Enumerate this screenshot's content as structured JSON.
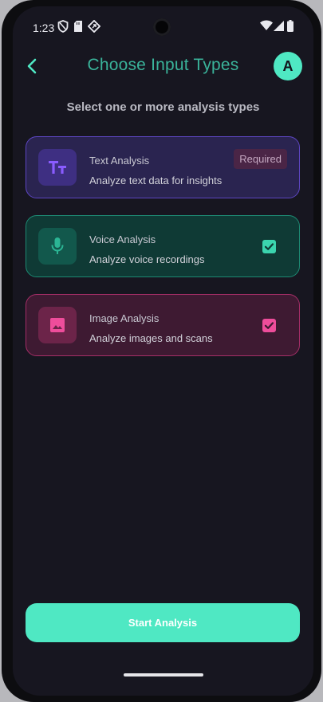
{
  "status_bar": {
    "time": "1:23",
    "icons": [
      "shield-icon",
      "sd-card-icon",
      "link-icon",
      "wifi-icon",
      "signal-icon",
      "battery-icon"
    ]
  },
  "header": {
    "title": "Choose Input Types",
    "back_icon": "chevron-left-icon",
    "avatar_initial": "A"
  },
  "subtitle": "Select one or more analysis types",
  "options": [
    {
      "title": "Text Analysis",
      "description": "Analyze text data for insights",
      "badge": "Required",
      "icon": "text-format-icon",
      "selected": true,
      "accent": "#5d46c2"
    },
    {
      "title": "Voice Analysis",
      "description": "Analyze voice recordings",
      "icon": "microphone-icon",
      "selected": true,
      "accent": "#3bd4ae"
    },
    {
      "title": "Image Analysis",
      "description": "Analyze images and scans",
      "icon": "image-icon",
      "selected": true,
      "accent": "#ee4d9b"
    }
  ],
  "start_button": {
    "label": "Start Analysis"
  },
  "colors": {
    "background": "#171620",
    "primary": "#4fe8c3",
    "title": "#3ab39a"
  }
}
